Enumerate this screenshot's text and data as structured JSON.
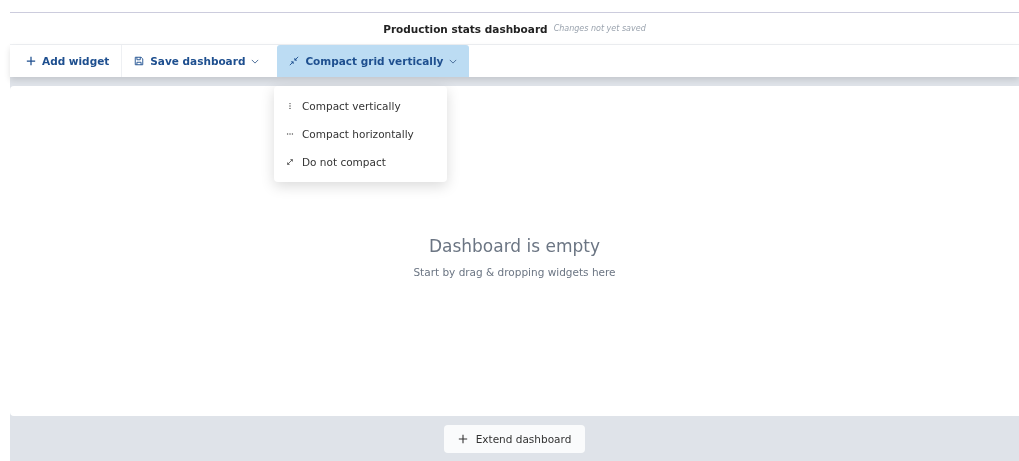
{
  "header": {
    "title": "Production stats dashboard",
    "status": "Changes not yet saved"
  },
  "toolbar": [
    {
      "label": "Add widget",
      "kind": "add",
      "dropdown": false,
      "active": false
    },
    {
      "label": "Save dashboard",
      "kind": "save",
      "dropdown": true,
      "active": false
    },
    {
      "label": "Compact grid vertically",
      "kind": "compact",
      "dropdown": true,
      "active": true
    }
  ],
  "menu": [
    {
      "label": "Compact vertically",
      "kind": "vertical"
    },
    {
      "label": "Compact horizontally",
      "kind": "horizontal"
    },
    {
      "label": "Do not compact",
      "kind": "none"
    }
  ],
  "empty_state": {
    "title": "Dashboard is empty",
    "hint": "Start by drag & dropping widgets here"
  },
  "extend_button": {
    "label": "Extend dashboard"
  }
}
